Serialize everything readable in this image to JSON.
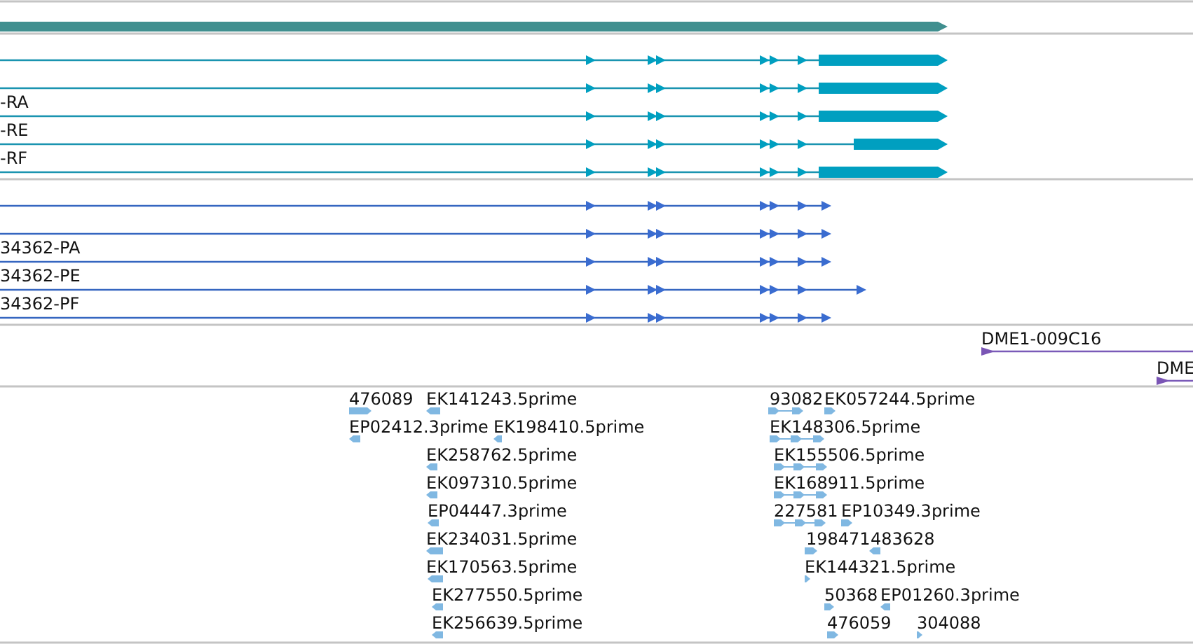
{
  "gene_track": {
    "features": [
      {
        "kind": "gene"
      }
    ]
  },
  "transcript_track": {
    "transcripts": [
      {
        "kind": "mrna"
      },
      {
        "kind": "mrna"
      },
      {
        "kind": "mrna",
        "label": "-RA"
      },
      {
        "kind": "mrna",
        "label": "-RE"
      },
      {
        "kind": "mrna",
        "label": "-RF"
      }
    ]
  },
  "protein_track": {
    "proteins": [
      {
        "kind": "protein"
      },
      {
        "kind": "protein"
      },
      {
        "kind": "protein",
        "label": "34362-PA"
      },
      {
        "kind": "protein",
        "label": "34362-PE"
      },
      {
        "kind": "protein",
        "label": "34362-PF"
      }
    ]
  },
  "clone_track": {
    "clones": [
      {
        "label": "DME1-009C16"
      },
      {
        "label": "DME"
      }
    ]
  },
  "est_track": {
    "ests": [
      {
        "label": "476089",
        "reverse": false
      },
      {
        "label": "EK141243.5prime",
        "reverse": true
      },
      {
        "label": "EP02412.3prime",
        "reverse": true
      },
      {
        "label": "EK198410.5prime",
        "reverse": true
      },
      {
        "label": "EK258762.5prime",
        "reverse": true
      },
      {
        "label": "EK097310.5prime",
        "reverse": true
      },
      {
        "label": "EP04447.3prime",
        "reverse": true
      },
      {
        "label": "EK234031.5prime",
        "reverse": true
      },
      {
        "label": "EK170563.5prime",
        "reverse": true
      },
      {
        "label": "EK277550.5prime",
        "reverse": true
      },
      {
        "label": "EK256639.5prime",
        "reverse": true
      },
      {
        "label": "93082",
        "reverse": false
      },
      {
        "label": "EK057244.5prime",
        "reverse": false
      },
      {
        "label": "EK148306.5prime",
        "reverse": false
      },
      {
        "label": "EK155506.5prime",
        "reverse": false
      },
      {
        "label": "EK168911.5prime",
        "reverse": false
      },
      {
        "label": "227581",
        "reverse": false
      },
      {
        "label": "EP10349.3prime",
        "reverse": false
      },
      {
        "label": "198471",
        "reverse": false
      },
      {
        "label": "483628",
        "reverse": true
      },
      {
        "label": "EK144321.5prime",
        "reverse": false
      },
      {
        "label": "50368",
        "reverse": false
      },
      {
        "label": "EP01260.3prime",
        "reverse": true
      },
      {
        "label": "476059",
        "reverse": false
      },
      {
        "label": "304088",
        "reverse": false
      }
    ]
  }
}
